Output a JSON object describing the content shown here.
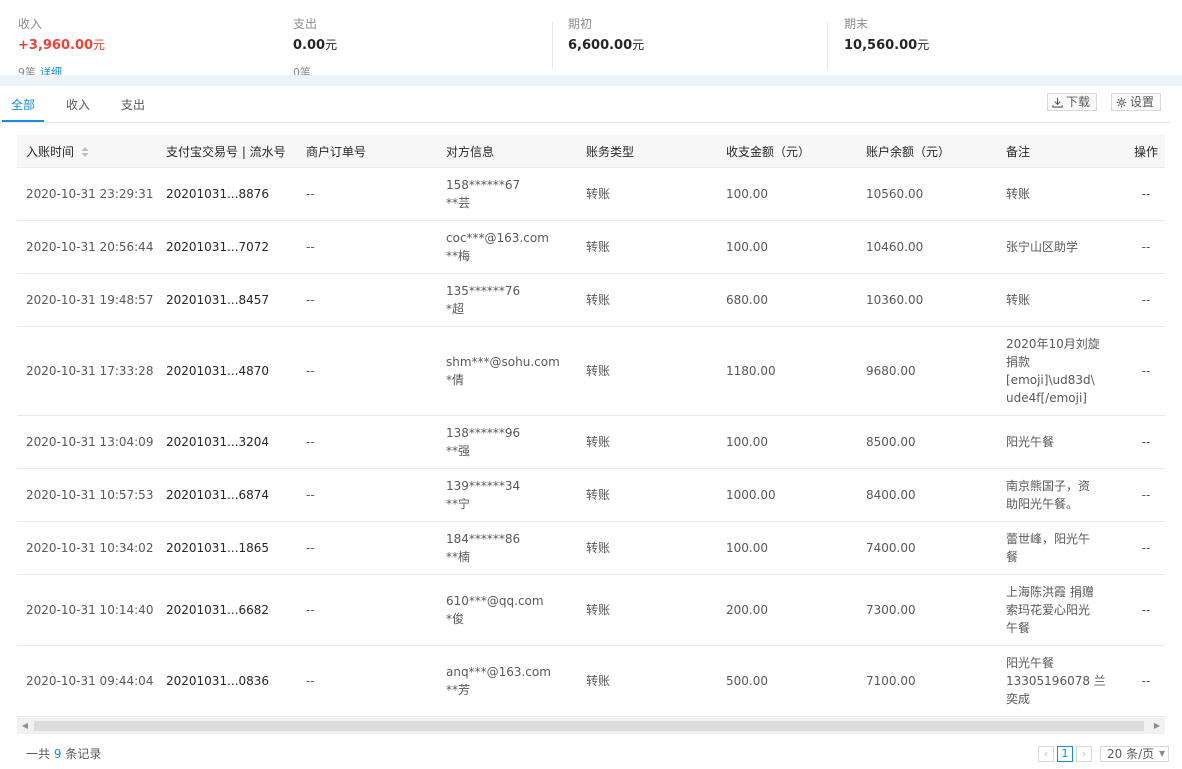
{
  "summary": [
    {
      "label": "收入",
      "value": "+3,960.00",
      "unit": "元",
      "sub": "9笔",
      "sub_link": "详细"
    },
    {
      "label": "支出",
      "value": "0.00",
      "unit": "元",
      "sub": "0笔",
      "sub_link": ""
    },
    {
      "label": "期初",
      "value": "6,600.00",
      "unit": "元",
      "sub": "",
      "sub_link": ""
    },
    {
      "label": "期末",
      "value": "10,560.00",
      "unit": "元",
      "sub": "",
      "sub_link": ""
    }
  ],
  "tabs": [
    "全部",
    "收入",
    "支出"
  ],
  "toolbar": {
    "download_label": "下载",
    "settings_label": "设置"
  },
  "columns": [
    "入账时间",
    "支付宝交易号 | 流水号",
    "商户订单号",
    "对方信息",
    "账务类型",
    "收支金额（元）",
    "账户余额（元）",
    "备注",
    "操作"
  ],
  "rows": [
    {
      "time": "2020-10-31 23:29:31",
      "trade_no": "20201031...8876",
      "order_no": "--",
      "party_account": "158******67",
      "party_name": "**芸",
      "type": "转账",
      "amount": "100.00",
      "balance": "10560.00",
      "remark": [
        "转账"
      ],
      "op": "--"
    },
    {
      "time": "2020-10-31 20:56:44",
      "trade_no": "20201031...7072",
      "order_no": "--",
      "party_account": "coc***@163.com",
      "party_name": "**梅",
      "type": "转账",
      "amount": "100.00",
      "balance": "10460.00",
      "remark": [
        "张宁山区助学"
      ],
      "op": "--"
    },
    {
      "time": "2020-10-31 19:48:57",
      "trade_no": "20201031...8457",
      "order_no": "--",
      "party_account": "135******76",
      "party_name": "*超",
      "type": "转账",
      "amount": "680.00",
      "balance": "10360.00",
      "remark": [
        "转账"
      ],
      "op": "--"
    },
    {
      "time": "2020-10-31 17:33:28",
      "trade_no": "20201031...4870",
      "order_no": "--",
      "party_account": "shm***@sohu.com",
      "party_name": "*倩",
      "type": "转账",
      "amount": "1180.00",
      "balance": "9680.00",
      "remark": [
        "2020年10月刘旋",
        "捐款",
        "[emoji]\\ud83d\\",
        "ude4f[/emoji]"
      ],
      "op": "--"
    },
    {
      "time": "2020-10-31 13:04:09",
      "trade_no": "20201031...3204",
      "order_no": "--",
      "party_account": "138******96",
      "party_name": "**强",
      "type": "转账",
      "amount": "100.00",
      "balance": "8500.00",
      "remark": [
        "阳光午餐"
      ],
      "op": "--"
    },
    {
      "time": "2020-10-31 10:57:53",
      "trade_no": "20201031...6874",
      "order_no": "--",
      "party_account": "139******34",
      "party_name": "**宁",
      "type": "转账",
      "amount": "1000.00",
      "balance": "8400.00",
      "remark": [
        "南京熊国子，资",
        "助阳光午餐。"
      ],
      "op": "--"
    },
    {
      "time": "2020-10-31 10:34:02",
      "trade_no": "20201031...1865",
      "order_no": "--",
      "party_account": "184******86",
      "party_name": "**楠",
      "type": "转账",
      "amount": "100.00",
      "balance": "7400.00",
      "remark": [
        "蕾世峰，阳光午",
        "餐"
      ],
      "op": "--"
    },
    {
      "time": "2020-10-31 10:14:40",
      "trade_no": "20201031...6682",
      "order_no": "--",
      "party_account": "610***@qq.com",
      "party_name": "*俊",
      "type": "转账",
      "amount": "200.00",
      "balance": "7300.00",
      "remark": [
        "上海陈洪霞 捐赠",
        "索玛花爱心阳光",
        "午餐"
      ],
      "op": "--"
    },
    {
      "time": "2020-10-31 09:44:04",
      "trade_no": "20201031...0836",
      "order_no": "--",
      "party_account": "anq***@163.com",
      "party_name": "**芳",
      "type": "转账",
      "amount": "500.00",
      "balance": "7100.00",
      "remark": [
        "阳光午餐",
        "13305196078 兰",
        "奕成"
      ],
      "op": "--"
    }
  ],
  "footer": {
    "total_prefix": "一共",
    "total_count": "9",
    "total_suffix": "条记录",
    "current_page": "1",
    "page_size": "20 条/页"
  },
  "colors": {
    "accent": "#108ee9",
    "income": "#f04134"
  }
}
